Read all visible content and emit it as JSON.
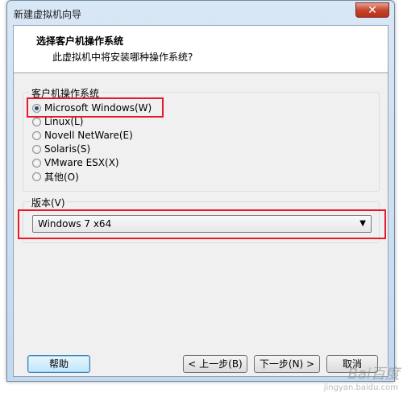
{
  "window": {
    "title": "新建虚拟机向导",
    "close_glyph": "✕"
  },
  "header": {
    "title": "选择客户机操作系统",
    "subtitle": "此虚拟机中将安装哪种操作系统?"
  },
  "os_group": {
    "legend": "客户机操作系统",
    "options": [
      {
        "label": "Microsoft Windows(W)",
        "checked": true
      },
      {
        "label": "Linux(L)",
        "checked": false
      },
      {
        "label": "Novell NetWare(E)",
        "checked": false
      },
      {
        "label": "Solaris(S)",
        "checked": false
      },
      {
        "label": "VMware ESX(X)",
        "checked": false
      },
      {
        "label": "其他(O)",
        "checked": false
      }
    ]
  },
  "version_group": {
    "legend": "版本(V)",
    "selected": "Windows 7 x64",
    "arrow": "▼"
  },
  "buttons": {
    "help": "帮助",
    "back": "< 上一步(B)",
    "next": "下一步(N) >",
    "cancel": "取消"
  },
  "watermark": {
    "main": "Bai百度",
    "sub": "jingyan.baidu.com"
  },
  "colors": {
    "highlight_box": "#e8192c",
    "client_bg": "#f0f0f0"
  }
}
